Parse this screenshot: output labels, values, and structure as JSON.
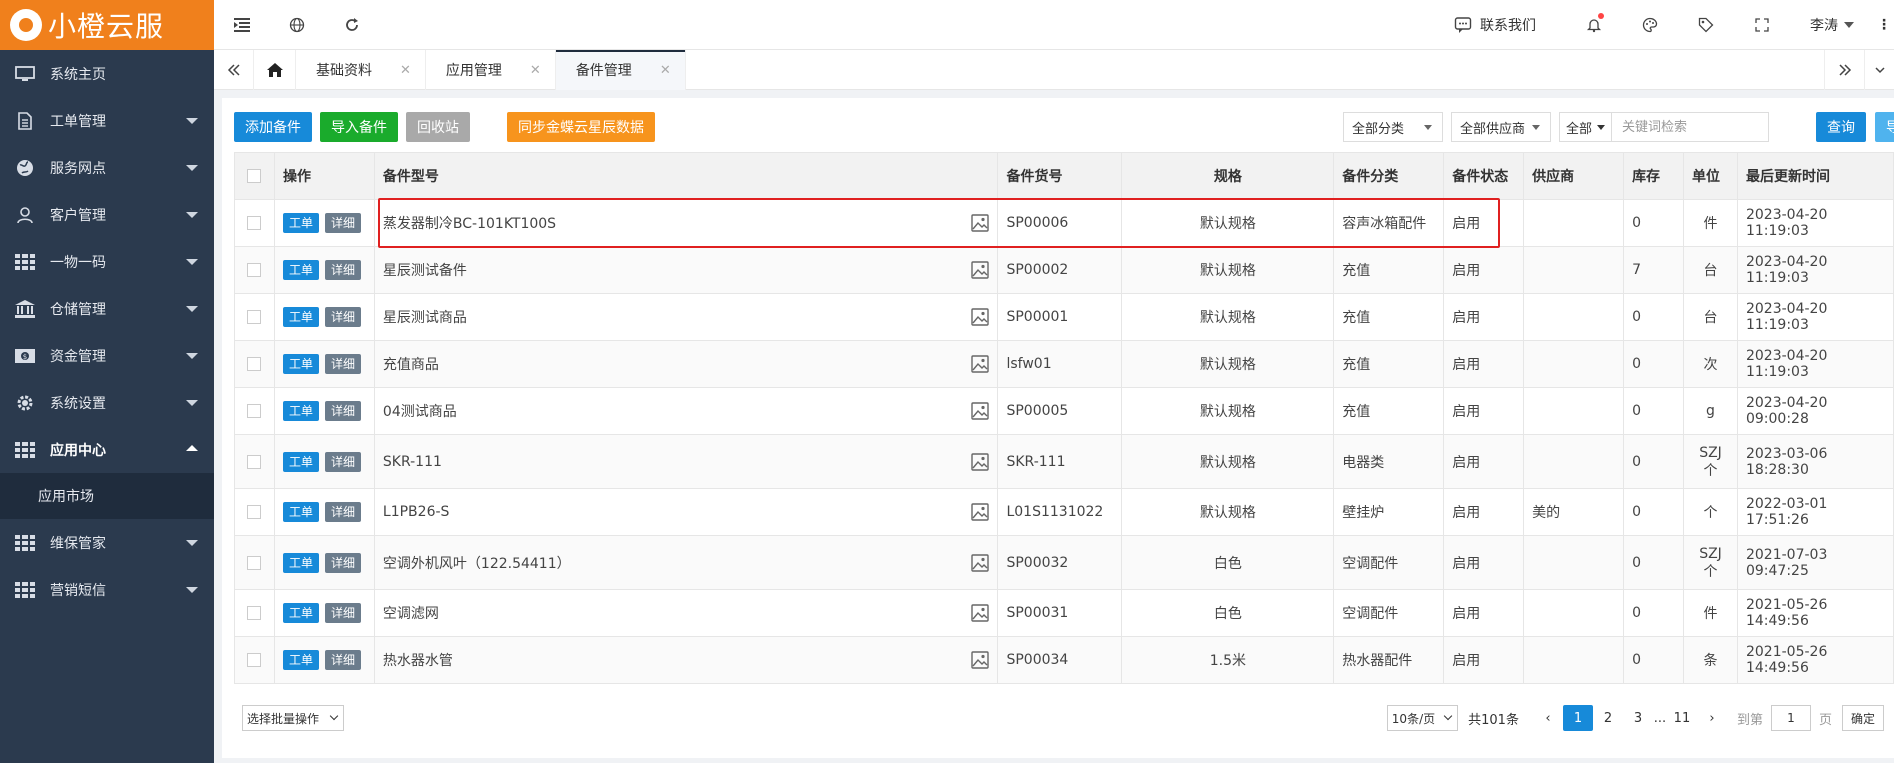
{
  "brand": {
    "name": "小橙云服"
  },
  "sidebar": {
    "items": [
      {
        "label": "系统主页",
        "icon": "monitor-icon"
      },
      {
        "label": "工单管理",
        "icon": "document-icon"
      },
      {
        "label": "服务网点",
        "icon": "globe-icon"
      },
      {
        "label": "客户管理",
        "icon": "user-icon"
      },
      {
        "label": "一物一码",
        "icon": "grid-icon"
      },
      {
        "label": "仓储管理",
        "icon": "bank-icon"
      },
      {
        "label": "资金管理",
        "icon": "money-icon"
      },
      {
        "label": "系统设置",
        "icon": "gear-icon"
      },
      {
        "label": "应用中心",
        "icon": "grid-icon"
      },
      {
        "label": "维保管家",
        "icon": "grid-icon"
      },
      {
        "label": "营销短信",
        "icon": "grid-icon"
      }
    ],
    "submenu": {
      "label": "应用市场"
    }
  },
  "header": {
    "contact": "联系我们",
    "user": "李涛"
  },
  "tabs": [
    {
      "label": "基础资料"
    },
    {
      "label": "应用管理"
    },
    {
      "label": "备件管理"
    }
  ],
  "toolbar": {
    "add": "添加备件",
    "import": "导入备件",
    "recycle": "回收站",
    "sync": "同步金蝶云星辰数据",
    "category_filter": "全部分类",
    "supplier_filter": "全部供应商",
    "search_scope": "全部",
    "search_placeholder": "关键词检索",
    "query": "查询",
    "export": "导出"
  },
  "table": {
    "headers": [
      "操作",
      "备件型号",
      "备件货号",
      "规格",
      "备件分类",
      "备件状态",
      "供应商",
      "库存",
      "单位",
      "最后更新时间"
    ],
    "op_labels": {
      "order": "工单",
      "detail": "详细"
    },
    "rows": [
      {
        "model": "蒸发器制冷BC-101KT100S",
        "sku": "SP00006",
        "spec": "默认规格",
        "category": "容声冰箱配件",
        "status": "启用",
        "supplier": "",
        "stock": "0",
        "unit": "件",
        "updated": "2023-04-20 11:19:03"
      },
      {
        "model": "星辰测试备件",
        "sku": "SP00002",
        "spec": "默认规格",
        "category": "充值",
        "status": "启用",
        "supplier": "",
        "stock": "7",
        "unit": "台",
        "updated": "2023-04-20 11:19:03"
      },
      {
        "model": "星辰测试商品",
        "sku": "SP00001",
        "spec": "默认规格",
        "category": "充值",
        "status": "启用",
        "supplier": "",
        "stock": "0",
        "unit": "台",
        "updated": "2023-04-20 11:19:03"
      },
      {
        "model": "充值商品",
        "sku": "lsfw01",
        "spec": "默认规格",
        "category": "充值",
        "status": "启用",
        "supplier": "",
        "stock": "0",
        "unit": "次",
        "updated": "2023-04-20 11:19:03"
      },
      {
        "model": "04测试商品",
        "sku": "SP00005",
        "spec": "默认规格",
        "category": "充值",
        "status": "启用",
        "supplier": "",
        "stock": "0",
        "unit": "g",
        "updated": "2023-04-20 09:00:28"
      },
      {
        "model": "SKR-111",
        "sku": "SKR-111",
        "spec": "默认规格",
        "category": "电器类",
        "status": "启用",
        "supplier": "",
        "stock": "0",
        "unit": "SZJ个",
        "updated": "2023-03-06 18:28:30"
      },
      {
        "model": "L1PB26-S",
        "sku": "L01S1131022",
        "spec": "默认规格",
        "category": "壁挂炉",
        "status": "启用",
        "supplier": "美的",
        "stock": "0",
        "unit": "个",
        "updated": "2022-03-01 17:51:26"
      },
      {
        "model": "空调外机风叶（122.54411）",
        "sku": "SP00032",
        "spec": "白色",
        "category": "空调配件",
        "status": "启用",
        "supplier": "",
        "stock": "0",
        "unit": "SZJ个",
        "updated": "2021-07-03 09:47:25"
      },
      {
        "model": "空调滤网",
        "sku": "SP00031",
        "spec": "白色",
        "category": "空调配件",
        "status": "启用",
        "supplier": "",
        "stock": "0",
        "unit": "件",
        "updated": "2021-05-26 14:49:56"
      },
      {
        "model": "热水器水管",
        "sku": "SP00034",
        "spec": "1.5米",
        "category": "热水器配件",
        "status": "启用",
        "supplier": "",
        "stock": "0",
        "unit": "条",
        "updated": "2021-05-26 14:49:56"
      }
    ]
  },
  "footer": {
    "batch": "选择批量操作",
    "per_page": "10条/页",
    "total": "共101条",
    "pages": [
      "1",
      "2",
      "3",
      "...",
      "11"
    ],
    "goto_label": "到第",
    "goto_value": "1",
    "page_unit": "页",
    "confirm": "确定"
  },
  "colors": {
    "brand_orange": "#f0801c",
    "sidebar_bg": "#2b3a4e",
    "primary_blue": "#178ad9",
    "green": "#1aab2c",
    "highlight_red": "#e02020"
  }
}
